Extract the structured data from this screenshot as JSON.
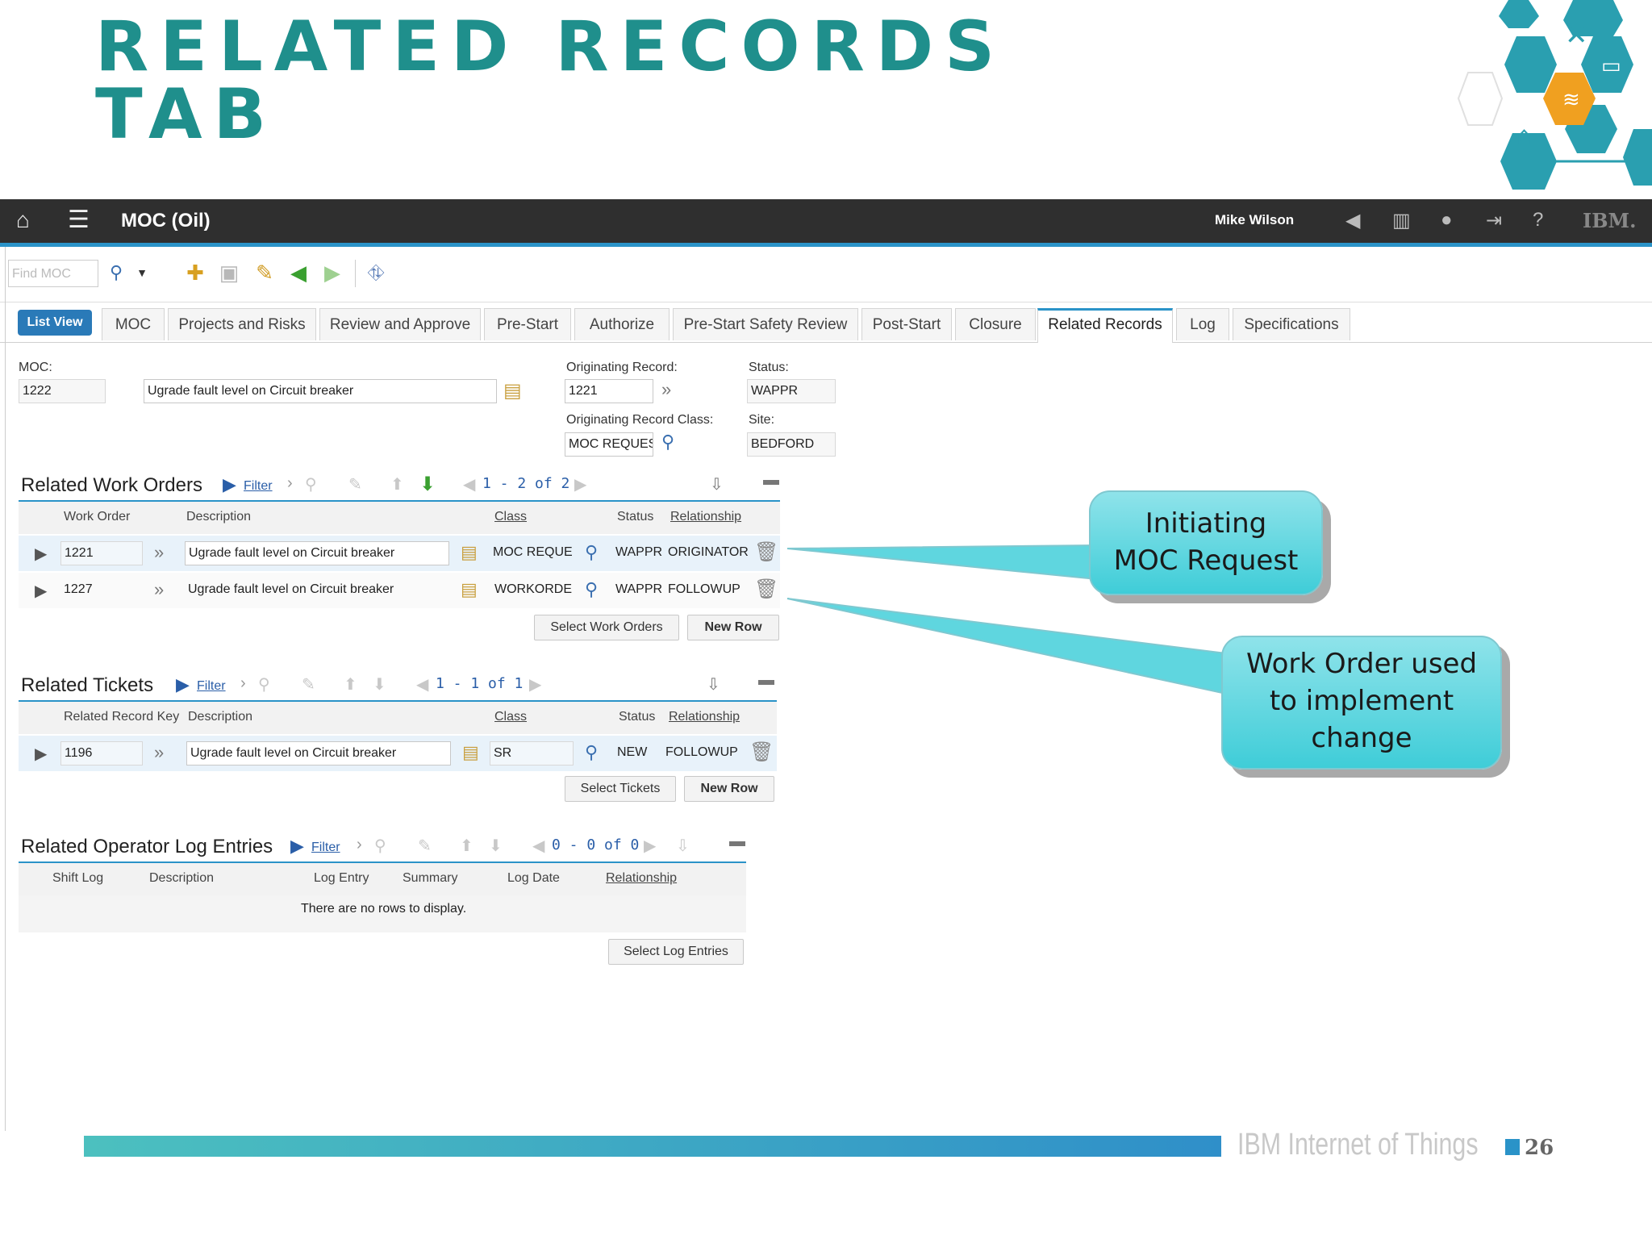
{
  "slide": {
    "title_line1": "Related Records",
    "title_line2": "Tab",
    "footer_brand": "IBM Internet of Things",
    "page_number": "26"
  },
  "app": {
    "title": "MOC (Oil)",
    "user": "Mike Wilson",
    "brand": "IBM."
  },
  "toolbar": {
    "find_placeholder": "Find MOC"
  },
  "tabs": {
    "list_view": "List View",
    "items": [
      "MOC",
      "Projects and Risks",
      "Review and Approve",
      "Pre-Start",
      "Authorize",
      "Pre-Start Safety Review",
      "Post-Start",
      "Closure",
      "Related Records",
      "Log",
      "Specifications"
    ],
    "active": "Related Records"
  },
  "form": {
    "moc_label": "MOC:",
    "moc_value": "1222",
    "moc_desc": "Ugrade fault level on Circuit breaker",
    "orig_record_label": "Originating Record:",
    "orig_record_value": "1221",
    "orig_class_label": "Originating Record Class:",
    "orig_class_value": "MOC REQUES",
    "status_label": "Status:",
    "status_value": "WAPPR",
    "site_label": "Site:",
    "site_value": "BEDFORD"
  },
  "work_orders": {
    "title": "Related Work Orders",
    "filter": "Filter",
    "pager": "1 - 2 of 2",
    "headers": [
      "Work Order",
      "Description",
      "Class",
      "Status",
      "Relationship"
    ],
    "rows": [
      {
        "id": "1221",
        "desc": "Ugrade fault level on Circuit breaker",
        "cls": "MOC REQUE",
        "status": "WAPPR",
        "rel": "ORIGINATOR"
      },
      {
        "id": "1227",
        "desc": "Ugrade fault level on Circuit breaker",
        "cls": "WORKORDE",
        "status": "WAPPR",
        "rel": "FOLLOWUP"
      }
    ],
    "select_btn": "Select Work Orders",
    "new_btn": "New Row"
  },
  "tickets": {
    "title": "Related Tickets",
    "filter": "Filter",
    "pager": "1 - 1 of 1",
    "headers": [
      "Related Record Key",
      "Description",
      "Class",
      "Status",
      "Relationship"
    ],
    "rows": [
      {
        "id": "1196",
        "desc": "Ugrade fault level on Circuit breaker",
        "cls": "SR",
        "status": "NEW",
        "rel": "FOLLOWUP"
      }
    ],
    "select_btn": "Select Tickets",
    "new_btn": "New Row"
  },
  "log_entries": {
    "title": "Related Operator Log Entries",
    "filter": "Filter",
    "pager": "0 - 0 of 0",
    "headers": [
      "Shift Log",
      "Description",
      "Log Entry",
      "Summary",
      "Log Date",
      "Relationship"
    ],
    "empty": "There are no rows to display.",
    "select_btn": "Select Log Entries"
  },
  "callouts": {
    "first": [
      "Initiating",
      "MOC Request"
    ],
    "second": [
      "Work Order used",
      "to implement",
      "change"
    ]
  },
  "colors": {
    "title_teal": "#1f8f8c",
    "accent_blue": "#2a93c8",
    "callout_cyan": "#3fcdd8",
    "hex_teal": "#2a9fb0",
    "hex_orange": "#f0a020"
  }
}
